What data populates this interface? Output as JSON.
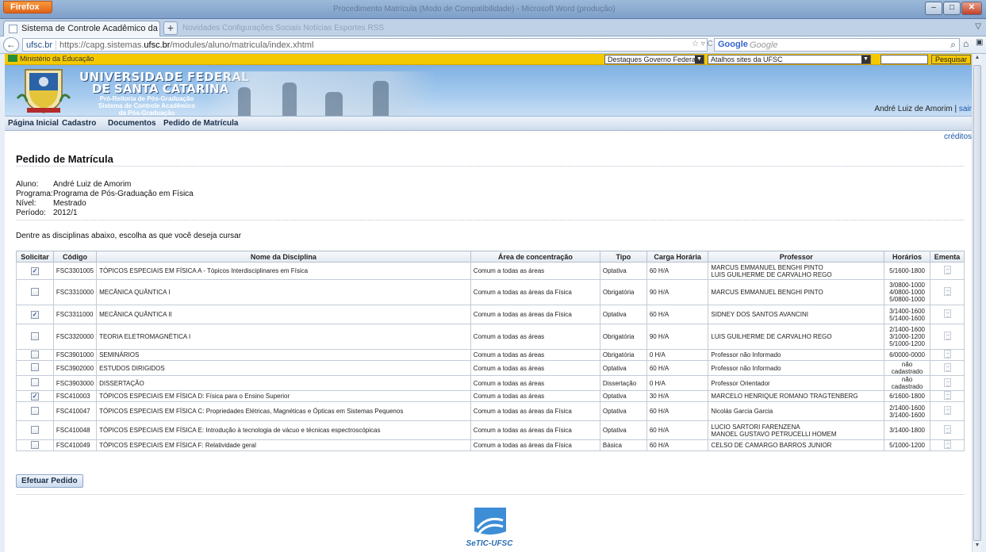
{
  "browser": {
    "menu_button": "Firefox",
    "window_title": "Procedimento Matrícula (Modo de Compatibilidade) - Microsoft Word (produção)",
    "tab_title": "Sistema de Controle Acadêmico da Pós-...",
    "other_tabs": "Novidades     Configurações     Sociais     Notícias     Esportes     RSS",
    "url_site": "ufsc.br",
    "url_prefix": "https://capg.sistemas.",
    "url_domain": "ufsc.br",
    "url_path": "/modules/aluno/matricula/index.xhtml",
    "search_engine": "Google",
    "search_placeholder": "Google"
  },
  "govbar": {
    "label": "Ministério da Educação",
    "select1": "Destaques Governo Federal",
    "select2": "Atalhos sites da UFSC",
    "search_button": "Pesquisar"
  },
  "header": {
    "line1": "UNIVERSIDADE FEDERAL",
    "line2": "DE SANTA CATARINA",
    "sub1": "Pró-Reitoria de Pós-Graduação",
    "sub2": "Sistema de Controle Acadêmico",
    "sub3": "da Pós-Graduação",
    "user_name": "André Luiz de Amorim",
    "separator": "|",
    "logout": "sair"
  },
  "menu": {
    "items": [
      "Página Inicial",
      "Cadastro",
      "Documentos",
      "Pedido de Matrícula"
    ]
  },
  "creditos": "créditos",
  "page": {
    "title": "Pedido de Matrícula",
    "aluno_label": "Aluno:",
    "aluno": "André Luiz de Amorim",
    "programa_label": "Programa:",
    "programa": "Programa de Pós-Graduação em Física",
    "nivel_label": "Nível:",
    "nivel": "Mestrado",
    "periodo_label": "Período:",
    "periodo": "2012/1",
    "instruction": "Dentre as disciplinas abaixo, escolha as que você deseja cursar",
    "submit": "Efetuar Pedido",
    "footer_logo": "SeTIC-UFSC"
  },
  "table": {
    "headers": [
      "Solicitar",
      "Código",
      "Nome da Disciplina",
      "Área de concentração",
      "Tipo",
      "Carga Horária",
      "Professor",
      "Horários",
      "Ementa"
    ],
    "rows": [
      {
        "checked": true,
        "codigo": "FSC3301005",
        "nome": "TÓPICOS ESPECIAIS EM FÍSICA A - Tópicos Interdisciplinares em Física",
        "area": "Comum a todas as áreas",
        "tipo": "Optativa",
        "carga": "60 H/A",
        "professor": [
          "MARCUS EMMANUEL BENGHI PINTO",
          "LUIS GUILHERME DE CARVALHO REGO"
        ],
        "horarios": [
          "5/1600-1800"
        ],
        "h": 22
      },
      {
        "checked": false,
        "codigo": "FSC3310000",
        "nome": "MECÂNICA QUÂNTICA I",
        "area": "Comum a todas as áreas da Física",
        "tipo": "Obrigatória",
        "carga": "90 H/A",
        "professor": [
          "MARCUS EMMANUEL BENGHI PINTO"
        ],
        "horarios": [
          "3/0800-1000",
          "4/0800-1000",
          "5/0800-1000"
        ],
        "h": 32
      },
      {
        "checked": true,
        "codigo": "FSC3311000",
        "nome": "MECÂNICA QUÂNTICA II",
        "area": "Comum a todas as áreas da Física",
        "tipo": "Optativa",
        "carga": "60 H/A",
        "professor": [
          "SIDNEY DOS SANTOS AVANCINI"
        ],
        "horarios": [
          "3/1400-1600",
          "5/1400-1600"
        ],
        "h": 24
      },
      {
        "checked": false,
        "codigo": "FSC3320000",
        "nome": "TEORIA ELETROMAGNÉTICA I",
        "area": "Comum a todas as áreas",
        "tipo": "Obrigatória",
        "carga": "90 H/A",
        "professor": [
          "LUIS GUILHERME DE CARVALHO REGO"
        ],
        "horarios": [
          "2/1400-1600",
          "3/1000-1200",
          "5/1000-1200"
        ],
        "h": 32
      },
      {
        "checked": false,
        "codigo": "FSC3901000",
        "nome": "SEMINÁRIOS",
        "area": "Comum a todas as áreas",
        "tipo": "Obrigatória",
        "carga": "0 H/A",
        "professor": [
          "Professor não Informado"
        ],
        "horarios": [
          "6/0000-0000"
        ],
        "h": 12
      },
      {
        "checked": false,
        "codigo": "FSC3902000",
        "nome": "ESTUDOS DIRIGIDOS",
        "area": "Comum a todas as áreas",
        "tipo": "Optativa",
        "carga": "60 H/A",
        "professor": [
          "Professor não Informado"
        ],
        "horarios": [
          "não cadastrado"
        ],
        "h": 12
      },
      {
        "checked": false,
        "codigo": "FSC3903000",
        "nome": "DISSERTAÇÃO",
        "area": "Comum a todas as áreas",
        "tipo": "Dissertação",
        "carga": "0 H/A",
        "professor": [
          "Professor Orientador"
        ],
        "horarios": [
          "não cadastrado"
        ],
        "h": 12
      },
      {
        "checked": true,
        "codigo": "FSC410003",
        "nome": "TÓPICOS ESPECIAIS EM FÍSICA D: Física para o Ensino Superior",
        "area": "Comum a todas as áreas",
        "tipo": "Optativa",
        "carga": "30 H/A",
        "professor": [
          "MARCELO HENRIQUE ROMANO TRAGTENBERG"
        ],
        "horarios": [
          "6/1600-1800"
        ],
        "h": 12
      },
      {
        "checked": false,
        "codigo": "FSC410047",
        "nome": "TÓPICOS ESPECIAIS EM FÍSICA C: Propriedades Elétricas, Magnéticas e Ópticas em Sistemas Pequenos",
        "area": "Comum a todas as áreas da Física",
        "tipo": "Optativa",
        "carga": "60 H/A",
        "professor": [
          "Nicolás Garcia Garcia"
        ],
        "horarios": [
          "2/1400-1600",
          "3/1400-1600"
        ],
        "h": 24
      },
      {
        "checked": false,
        "codigo": "FSC410048",
        "nome": "TÓPICOS ESPECIAIS EM FÍSICA E: Introdução à tecnologia de vácuo e técnicas espectroscópicas",
        "area": "Comum a todas as áreas da Física",
        "tipo": "Optativa",
        "carga": "60 H/A",
        "professor": [
          "LUCIO SARTORI FARENZENA",
          "MANOEL GUSTAVO PETRUCELLI HOMEM"
        ],
        "horarios": [
          "3/1400-1800"
        ],
        "h": 24
      },
      {
        "checked": false,
        "codigo": "FSC410049",
        "nome": "TÓPICOS ESPECIAIS EM FÍSICA F: Relatividade geral",
        "area": "Comum a todas as áreas da Física",
        "tipo": "Básica",
        "carga": "60 H/A",
        "professor": [
          "CELSO DE CAMARGO BARROS JUNIOR"
        ],
        "horarios": [
          "5/1000-1200"
        ],
        "h": 13
      }
    ]
  }
}
